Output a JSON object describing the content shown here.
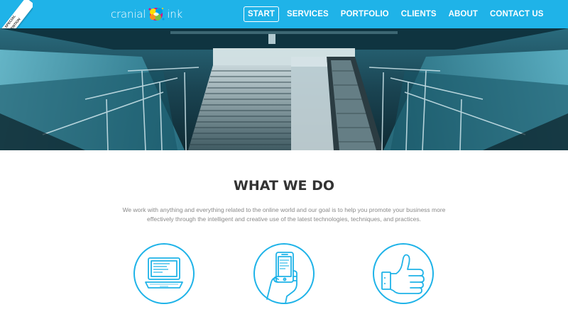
{
  "header": {
    "logo": {
      "left_text": "cranial",
      "right_text": "ink"
    },
    "nav": [
      {
        "label": "START",
        "active": true
      },
      {
        "label": "SERVICES",
        "active": false
      },
      {
        "label": "PORTFOLIO",
        "active": false
      },
      {
        "label": "CLIENTS",
        "active": false
      },
      {
        "label": "ABOUT",
        "active": false
      },
      {
        "label": "CONTACT US",
        "active": false
      }
    ],
    "ribbon": {
      "line1": "SPECIAL",
      "line2": "MENTION"
    }
  },
  "hero": {
    "icon": "staircase-photo"
  },
  "section": {
    "title": "WHAT WE DO",
    "description": "We work with anything and everything related to the online world and our goal is to help you promote your business more effectively through the intelligent and creative use of the latest technologies, techniques, and practices.",
    "icons": [
      "laptop-icon",
      "smartphone-hand-icon",
      "thumbs-up-icon"
    ]
  },
  "colors": {
    "accent": "#1fb3e8",
    "title": "#333333",
    "text": "#8a8a8a",
    "hero_tint": "#1d4d5c"
  }
}
